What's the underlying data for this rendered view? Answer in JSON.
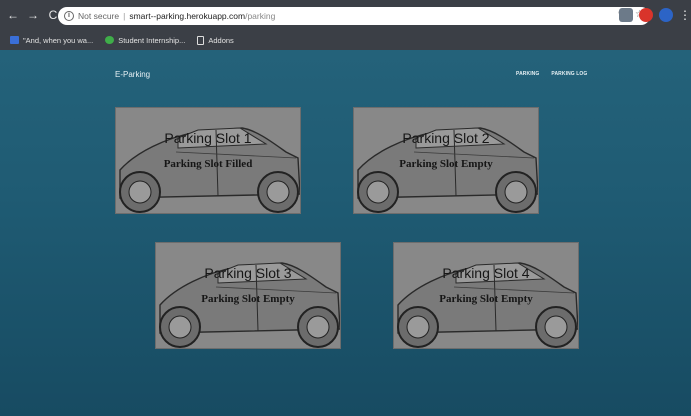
{
  "browser": {
    "not_secure": "Not secure",
    "separator": "|",
    "url_host": "smart--parking.herokuapp.com",
    "url_path": "/parking",
    "bookmarks": [
      {
        "label": "\"And, when you wa...",
        "icon": "bookmark-blue-icon"
      },
      {
        "label": "Student Internship...",
        "icon": "bookmark-green-icon"
      },
      {
        "label": "Addons",
        "icon": "document-icon"
      }
    ]
  },
  "navbar": {
    "brand": "E-Parking",
    "links": [
      "PARKING",
      "PARKING LOG"
    ]
  },
  "slots": [
    {
      "title": "Parking Slot 1",
      "status": "Parking Slot Filled"
    },
    {
      "title": "Parking Slot 2",
      "status": "Parking Slot Empty"
    },
    {
      "title": "Parking Slot 3",
      "status": "Parking Slot Empty"
    },
    {
      "title": "Parking Slot 4",
      "status": "Parking Slot Empty"
    }
  ],
  "colors": {
    "page_bg_top": "#24627a",
    "page_bg_bottom": "#174b62",
    "card_bg": "#8a8a8a",
    "chrome_bg": "#3b3f46"
  }
}
